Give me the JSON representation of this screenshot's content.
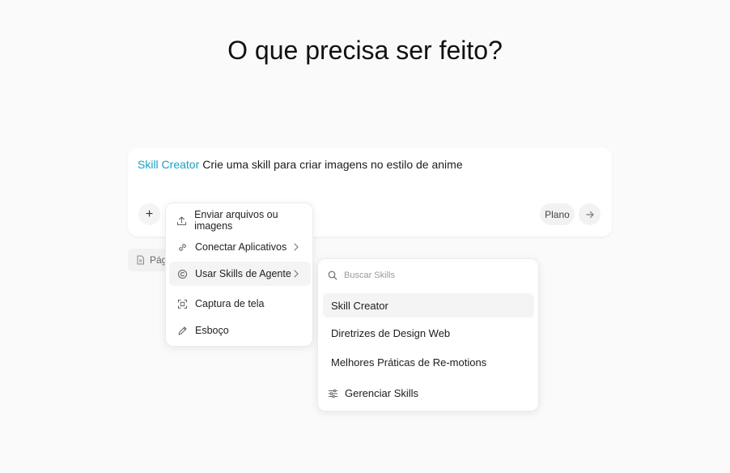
{
  "headline": "O que precisa ser feito?",
  "composer": {
    "skill_chip": "Skill Creator",
    "prompt_text": "Crie uma skill para criar imagens no estilo de anime",
    "plus_label": "+",
    "plan_label": "Plano"
  },
  "below_chip": {
    "label": "Pág"
  },
  "menu": {
    "items": [
      {
        "label": "Enviar arquivos ou imagens",
        "icon": "upload-icon"
      },
      {
        "label": "Conectar Aplicativos",
        "icon": "link-icon",
        "has_submenu": true
      },
      {
        "label": "Usar Skills de Agente",
        "icon": "skills-icon",
        "has_submenu": true,
        "active": true
      },
      {
        "label": "Captura de tela",
        "icon": "screenshot-icon"
      },
      {
        "label": "Esboço",
        "icon": "pen-icon"
      }
    ]
  },
  "skills_submenu": {
    "search_placeholder": "Buscar Skills",
    "items": [
      {
        "label": "Skill Creator",
        "active": true
      },
      {
        "label": "Diretrizes de Design Web"
      },
      {
        "label": "Melhores Práticas de Re-motions"
      }
    ],
    "manage_label": "Gerenciar Skills"
  },
  "colors": {
    "accent": "#1aa0c2",
    "background": "#fafafa"
  }
}
